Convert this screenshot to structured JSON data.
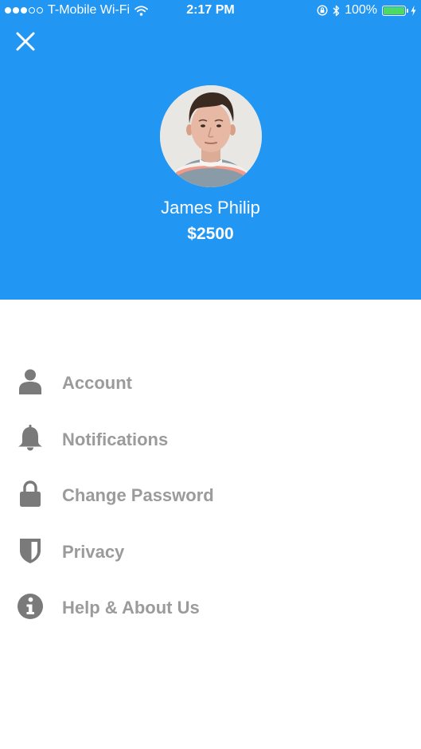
{
  "status_bar": {
    "carrier": "T-Mobile Wi-Fi",
    "time": "2:17 PM",
    "battery_percent": "100%",
    "battery_level": 1.0
  },
  "profile": {
    "name": "James Philip",
    "balance": "$2500"
  },
  "menu": {
    "items": [
      {
        "label": "Account",
        "icon": "user-icon"
      },
      {
        "label": "Notifications",
        "icon": "bell-icon"
      },
      {
        "label": "Change Password",
        "icon": "lock-icon"
      },
      {
        "label": "Privacy",
        "icon": "shield-icon"
      },
      {
        "label": "Help & About Us",
        "icon": "info-icon"
      }
    ]
  },
  "colors": {
    "header_background": "#2196F3",
    "menu_text": "#9b9b9b",
    "menu_icon": "#7a7a7a",
    "battery_fill": "#4cd964"
  }
}
